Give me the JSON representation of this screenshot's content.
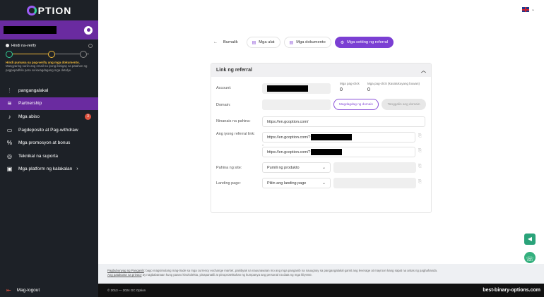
{
  "app": {
    "logo_text": "PTION"
  },
  "sidebar": {
    "verify": {
      "status": "Hindi na-verify",
      "title": "Hindi pumasa sa pag-verify ang mga dokumento.",
      "text": "Mangyaring suriin ang email na iyong ibinigay sa patahon ng pagpapadhilo para sa karagdagang mga detalye."
    },
    "items": [
      {
        "label": "pangangalakal",
        "icon": "trading-icon"
      },
      {
        "label": "Partnership",
        "icon": "handshake-icon"
      },
      {
        "label": "Mga abiso",
        "icon": "bell-icon",
        "badge": "3"
      },
      {
        "label": "Pagdeposito at Pag-withdraw",
        "icon": "wallet-icon"
      },
      {
        "label": "Mga promosyon at bonus",
        "icon": "percent-icon"
      },
      {
        "label": "Teknikal na suporta",
        "icon": "support-icon"
      },
      {
        "label": "Mga platform ng kalakalan",
        "icon": "monitor-icon"
      }
    ],
    "logout": "Mag-logout"
  },
  "tabs": {
    "back": "Bumalik",
    "reports": "Mga ulat",
    "documents": "Mga dokumento",
    "referral_settings": "Mga setting ng referral"
  },
  "card": {
    "title": "Link ng referral",
    "account_label": "Account:",
    "clicks_label": "Mga pag-click",
    "clicks_value": "0",
    "unique_clicks_label": "Mga pag-click (kasalukuyang buwan)",
    "unique_clicks_value": "0",
    "domain_label": "Domain:",
    "change_domain": "Magdagdag ng domain",
    "remove_domain": "Tanggalin ang domain",
    "page_name_label": "Ninanais na pahina:",
    "page_name_value": "https://en.gcoption.com/",
    "referral_link_label": "Ang iyong referral link:",
    "referral_link_1": "https://en.gcoption.com/?",
    "referral_link_2": "https://en.gcoption.com/?",
    "site_page_label": "Pahina ng site:",
    "site_page_select": "Pumili ng produkto",
    "landing_label": "Landing page:",
    "landing_select": "Piliin ang landing page"
  },
  "footer": {
    "disclaimer_link1": "Pagbubunyag ng Panganib",
    "disclaimer_text1": ": bago magsimulang mag-trade sa mga currency exchange market, pakibyak na nauunawaan mo ang mga panganib na nauugnay sa pangangalakal gamit ang leverage at mayroon kang sapat na antas ng paghahanda.",
    "disclaimer_link2": "Ang patakaran sa privacy",
    "disclaimer_text2": " ay nagbabanaan kung paano kinokolekta, pinapanatili at pinoprotektahan ng kumpanya ang personal na data ng mga kliyente.",
    "copyright": "© 2013 — 2024 GC Option",
    "brand": "best-binary-options.com"
  }
}
